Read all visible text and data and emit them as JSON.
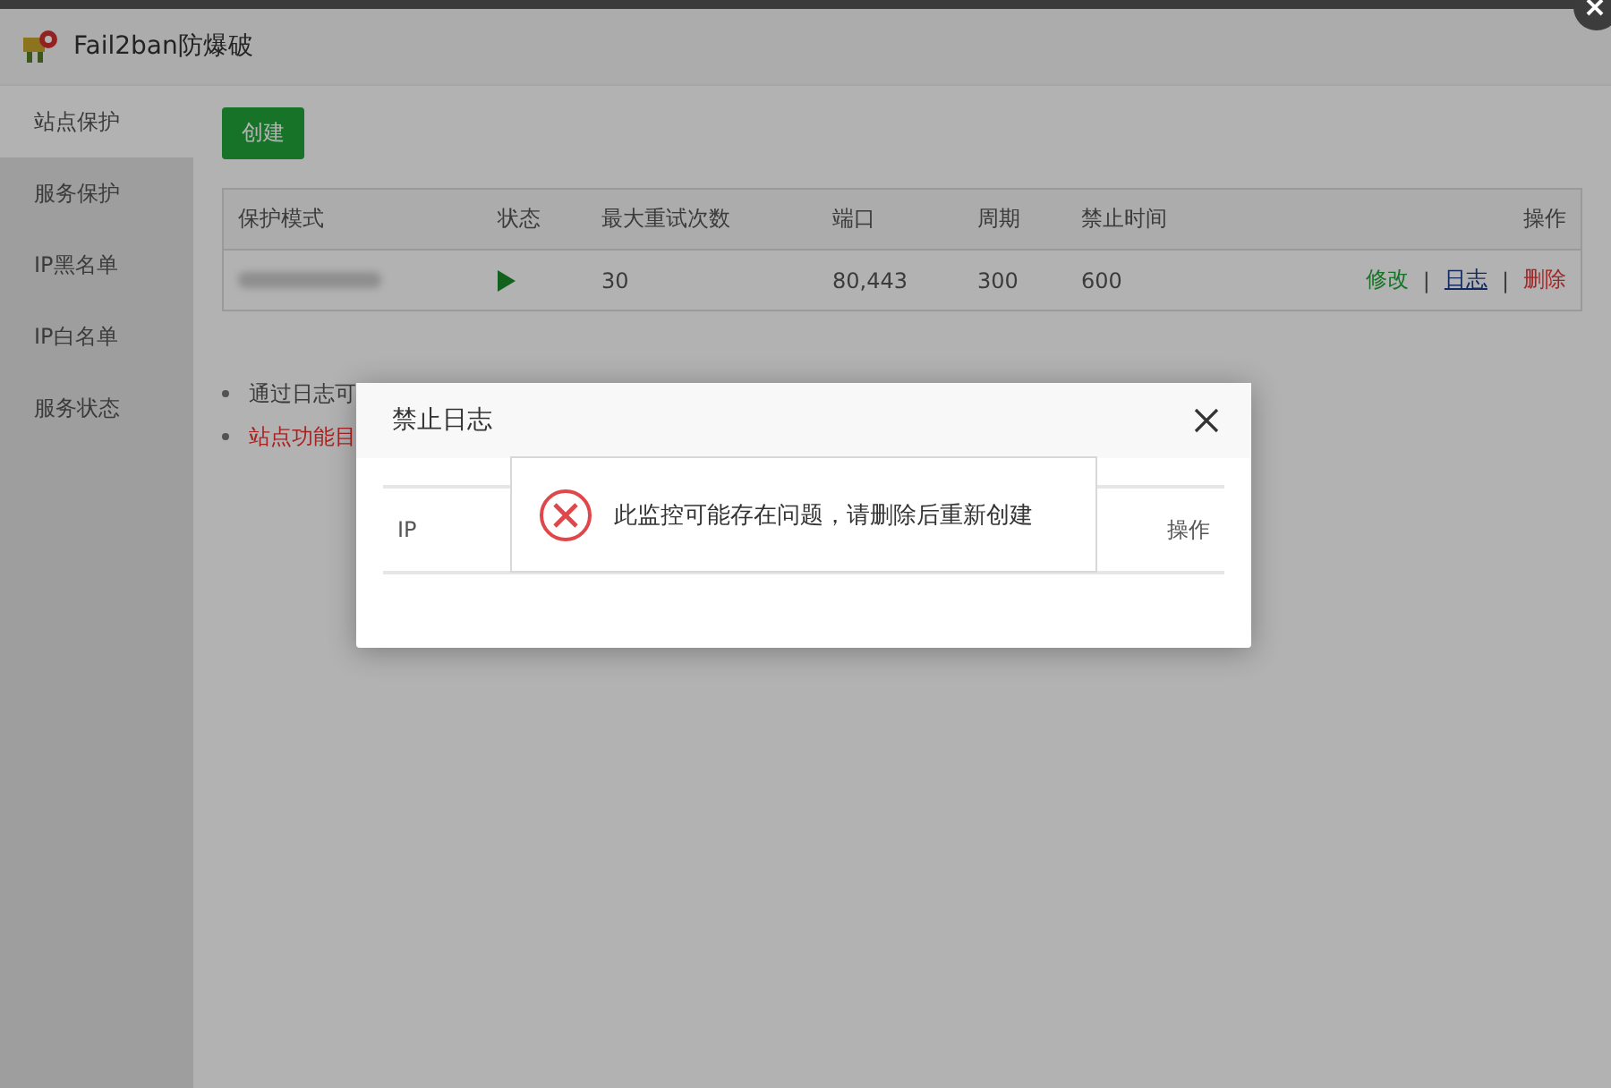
{
  "window": {
    "title": "Fail2ban防爆破"
  },
  "sidebar": {
    "items": [
      {
        "label": "站点保护",
        "selected": true
      },
      {
        "label": "服务保护",
        "selected": false
      },
      {
        "label": "IP黑名单",
        "selected": false
      },
      {
        "label": "IP白名单",
        "selected": false
      },
      {
        "label": "服务状态",
        "selected": false
      }
    ]
  },
  "create_button": "创建",
  "table": {
    "columns": [
      "保护模式",
      "状态",
      "最大重试次数",
      "端口",
      "周期",
      "禁止时间",
      "操作"
    ],
    "rows": [
      {
        "running": true,
        "max_retry": "30",
        "ports": "80,443",
        "period": "300",
        "ban_time": "600",
        "separator": "|",
        "actions": [
          {
            "label": "修改",
            "kind": "edit"
          },
          {
            "label": "日志",
            "kind": "log"
          },
          {
            "label": "删除",
            "kind": "delete"
          }
        ]
      }
    ]
  },
  "notes": [
    {
      "text": "通过日志可",
      "kind": "normal"
    },
    {
      "text": "站点功能目",
      "kind": "warning"
    }
  ],
  "dialog": {
    "title": "禁止日志",
    "columns": [
      "IP",
      "操作"
    ]
  },
  "toast": {
    "kind": "error",
    "message": "此监控可能存在问题，请删除后重新创建"
  }
}
